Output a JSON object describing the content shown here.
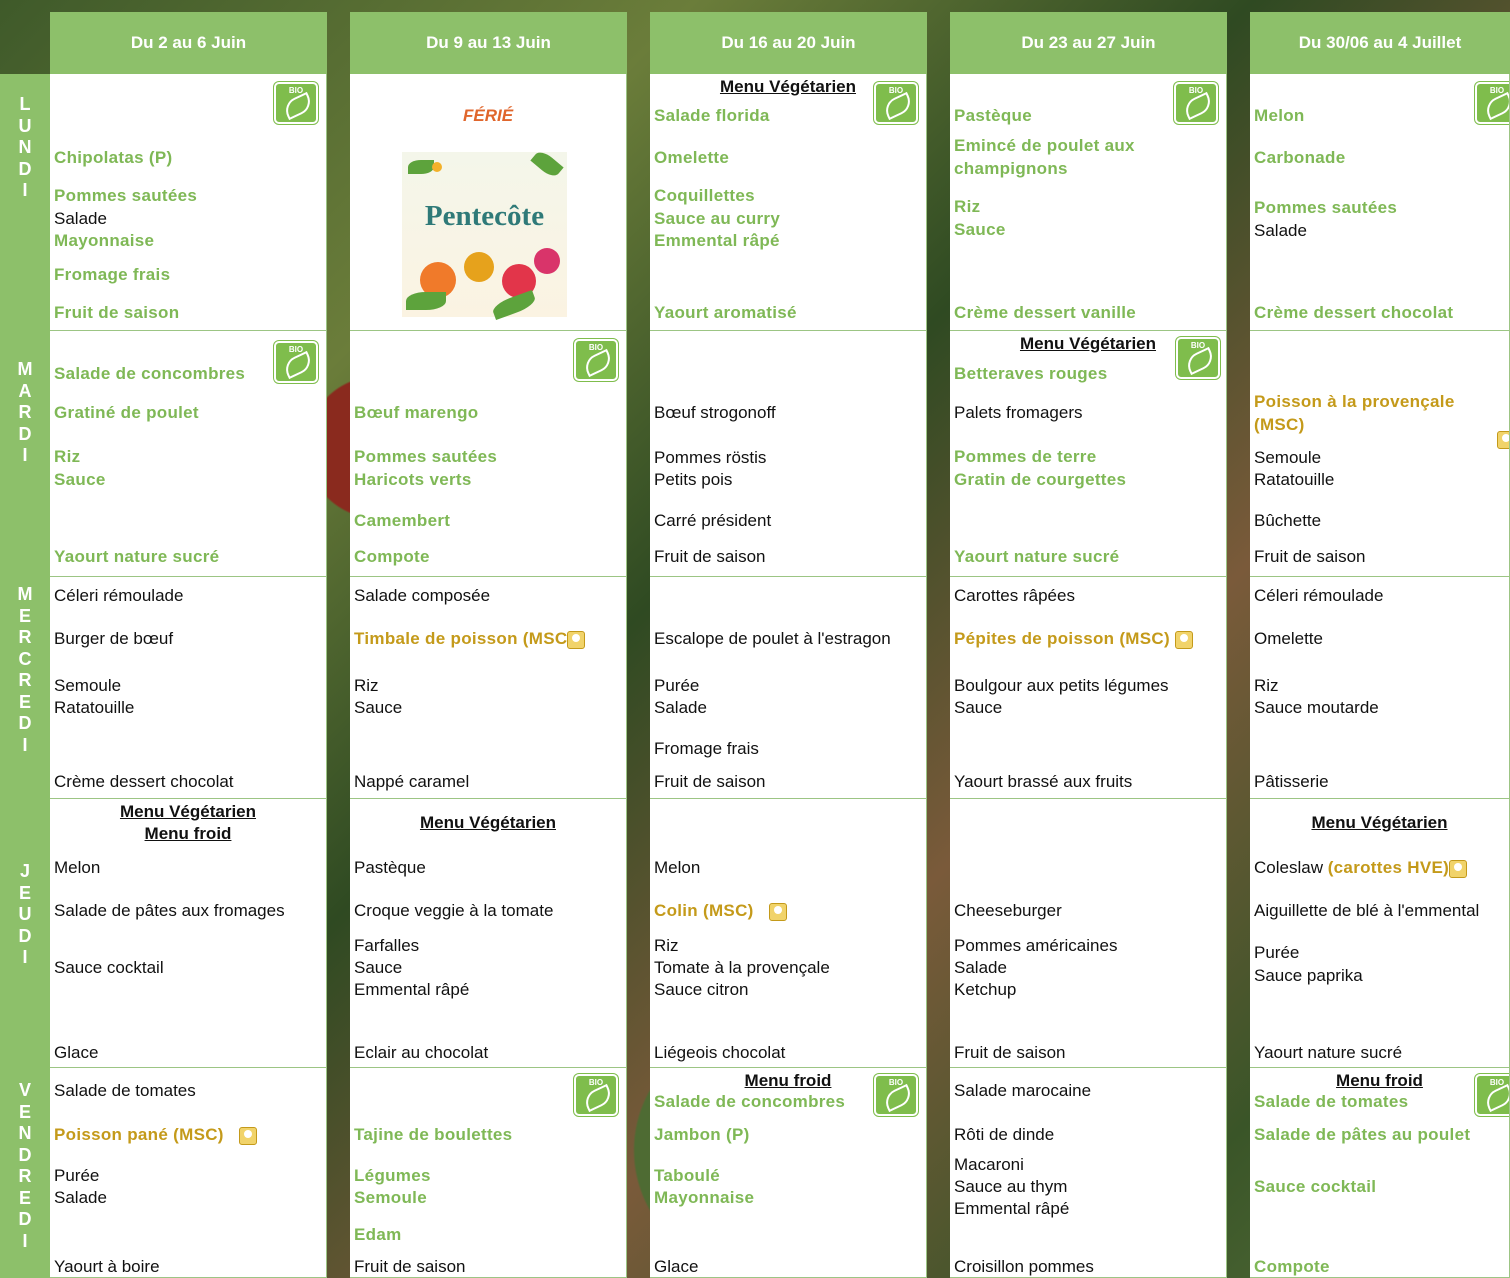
{
  "weeks": [
    "Du 2 au 6 Juin",
    "Du 9 au 13 Juin",
    "Du 16 au 20 Juin",
    "Du 23 au 27 Juin",
    "Du 30/06 au 4 Juillet"
  ],
  "days": [
    "L\nU\nN\nD\nI",
    "M\nA\nR\nD\nI",
    "M\nE\nR\nC\nR\nE\nD\nI",
    "J\nE\nU\nD\nI",
    "V\nE\nN\nD\nR\nE\nD\nI"
  ],
  "labels": {
    "bio": "BIO",
    "menu_vegetarien": "Menu Végétarien",
    "menu_froid": "Menu froid",
    "ferie": "FÉRIÉ",
    "pentecote": "Pentecôte"
  },
  "lundi": {
    "w1": {
      "a": "Chipolatas (P)",
      "b": "Pommes sautées",
      "c": "Salade",
      "d": "Mayonnaise",
      "e": "Fromage frais",
      "f": "Fruit de saison"
    },
    "w3": {
      "a": "Salade florida",
      "b": "Omelette",
      "c": "Coquillettes",
      "d": "Sauce au curry",
      "e": "Emmental râpé",
      "f": "Yaourt aromatisé"
    },
    "w4": {
      "a": "Pastèque",
      "b": "Emincé de poulet aux",
      "b2": "champignons",
      "c": "Riz",
      "d": "Sauce",
      "f": "Crème dessert vanille"
    },
    "w5": {
      "a": "Melon",
      "b": "Carbonade",
      "c": "Pommes sautées",
      "d": "Salade",
      "f": "Crème dessert chocolat"
    }
  },
  "mardi": {
    "w1": {
      "a": "Salade de concombres",
      "b": "Gratiné de poulet",
      "c": "Riz",
      "d": "Sauce",
      "f": "Yaourt nature sucré"
    },
    "w2": {
      "b": "Bœuf marengo",
      "c": "Pommes sautées",
      "d": "Haricots verts",
      "e": "Camembert",
      "f": "Compote"
    },
    "w3": {
      "b": "Bœuf strogonoff",
      "c": "Pommes röstis",
      "d": "Petits pois",
      "e": "Carré président",
      "f": "Fruit de saison"
    },
    "w4": {
      "a": "Betteraves rouges",
      "b": "Palets fromagers",
      "c": "Pommes de terre",
      "d": "Gratin de courgettes",
      "f": "Yaourt nature sucré"
    },
    "w5": {
      "b": "Poisson à la provençale",
      "b2": "(MSC)",
      "c": "Semoule",
      "d": "Ratatouille",
      "e": "Bûchette",
      "f": "Fruit de saison"
    }
  },
  "mercredi": {
    "w1": {
      "a": "Céleri rémoulade",
      "b": "Burger de bœuf",
      "c": "Semoule",
      "d": "Ratatouille",
      "f": "Crème dessert chocolat"
    },
    "w2": {
      "a": "Salade composée",
      "b": "Timbale de poisson (MSC",
      "c": "Riz",
      "d": "Sauce",
      "f": "Nappé caramel"
    },
    "w3": {
      "b": "Escalope de poulet à l'estragon",
      "c": "Purée",
      "d": "Salade",
      "e": "Fromage frais",
      "f": "Fruit de saison"
    },
    "w4": {
      "a": "Carottes râpées",
      "b": "Pépites de poisson (MSC)",
      "c": "Boulgour aux petits légumes",
      "d": "Sauce",
      "f": "Yaourt brassé aux fruits"
    },
    "w5": {
      "a": "Céleri rémoulade",
      "b": "Omelette",
      "c": "Riz",
      "d": "Sauce moutarde",
      "f": "Pâtisserie"
    }
  },
  "jeudi": {
    "w1": {
      "a": "Melon",
      "b": "Salade de pâtes aux fromages",
      "c": "Sauce cocktail",
      "f": "Glace"
    },
    "w2": {
      "a": "Pastèque",
      "b": "Croque veggie à la tomate",
      "c": "Farfalles",
      "d": "Sauce",
      "e": "Emmental râpé",
      "f": "Eclair au chocolat"
    },
    "w3": {
      "a": "Melon",
      "b": "Colin (MSC)",
      "c": "Riz",
      "d": "Tomate à la provençale",
      "e": "Sauce citron",
      "f": "Liégeois chocolat"
    },
    "w4": {
      "b": "Cheeseburger",
      "c": "Pommes américaines",
      "d": "Salade",
      "e": "Ketchup",
      "f": "Fruit de saison"
    },
    "w5": {
      "a": "Coleslaw",
      "a2": "(carottes HVE)",
      "b": "Aiguillette de blé à l'emmental",
      "c": "Purée",
      "d": "Sauce paprika",
      "f": "Yaourt nature sucré"
    }
  },
  "vendredi": {
    "w1": {
      "a": "Salade de tomates",
      "b": "Poisson pané (MSC)",
      "c": "Purée",
      "d": "Salade",
      "f": "Yaourt à boire"
    },
    "w2": {
      "b": "Tajine de boulettes",
      "c": "Légumes",
      "d": "Semoule",
      "e": "Edam",
      "f": "Fruit de saison"
    },
    "w3": {
      "a": "Salade de concombres",
      "b": "Jambon (P)",
      "c": "Taboulé",
      "d": "Mayonnaise",
      "f": "Glace"
    },
    "w4": {
      "a": "Salade marocaine",
      "b": "Rôti de dinde",
      "c": "Macaroni",
      "d": "Sauce au thym",
      "e": "Emmental râpé",
      "f": "Croisillon pommes"
    },
    "w5": {
      "a": "Salade de tomates",
      "b": "Salade de pâtes au poulet",
      "c": "Sauce cocktail",
      "f": "Compote"
    }
  },
  "colors": {
    "header": "#8dc06a",
    "bio_green": "#7fb856",
    "msc_gold": "#c49a1a"
  }
}
